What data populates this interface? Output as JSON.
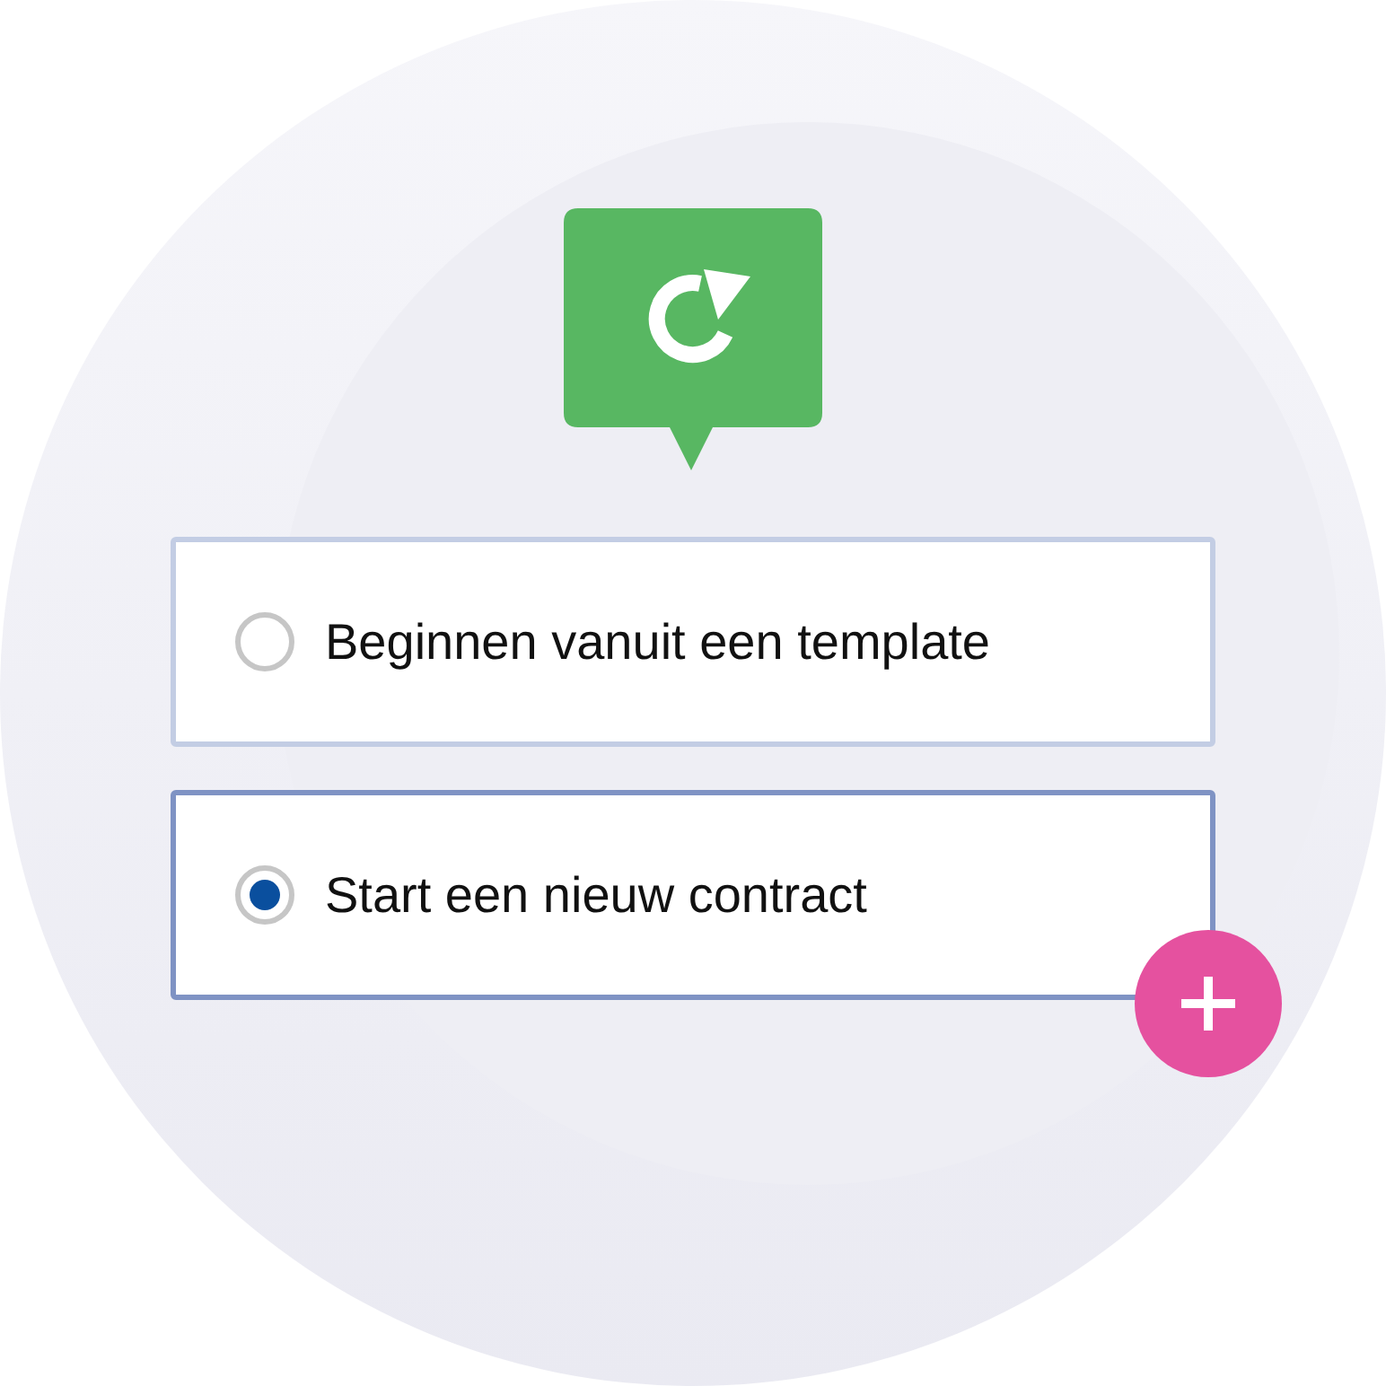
{
  "options": [
    {
      "label": "Beginnen vanuit een template",
      "selected": false
    },
    {
      "label": "Start een nieuw contract",
      "selected": true
    }
  ]
}
